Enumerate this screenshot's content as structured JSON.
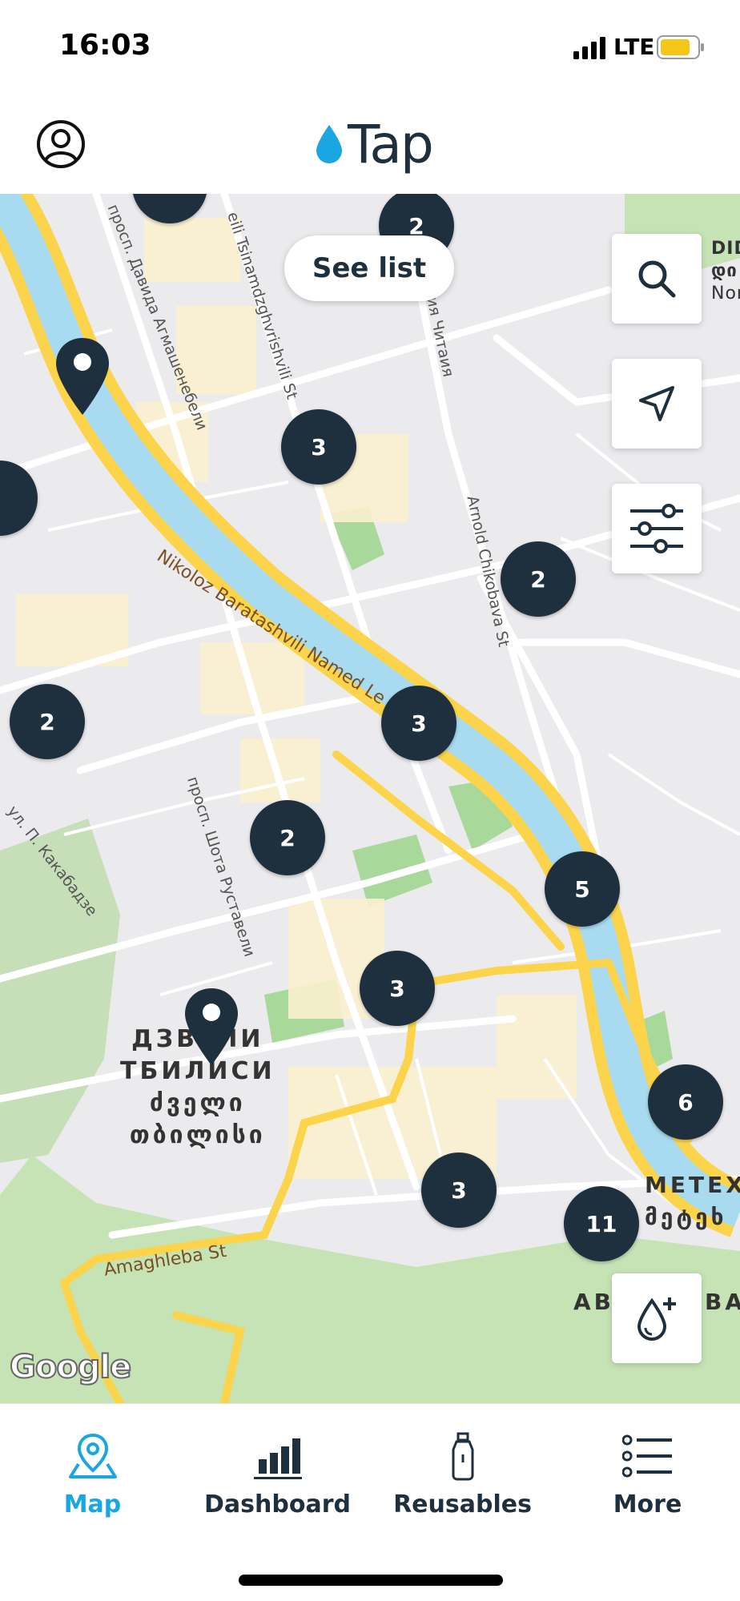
{
  "status_bar": {
    "time": "16:03",
    "network": "LTE",
    "battery_color": "#f5c518"
  },
  "header": {
    "logo_text": "Tap",
    "brand_color": "#1aa6e0",
    "profile_icon": "user-circle-icon"
  },
  "map": {
    "see_list_label": "See list",
    "controls": [
      "search-icon",
      "navigation-arrow-icon",
      "filter-sliders-icon",
      "add-refill-icon"
    ],
    "clusters": [
      "2",
      "3",
      "2",
      "2",
      "3",
      "2",
      "5",
      "3",
      "6",
      "3",
      "11"
    ],
    "labels": {
      "river_street": "Nikoloz Baratashvili Named Le",
      "arnold": "Arnold Chikobava St",
      "tsinamdzghvrishvili": "eili Tsinamdzghvrishvili St",
      "davida": "просп. Давида Агмашенебели",
      "chitaia": "ргия Читаия",
      "kakabadze": "ул. П. Какабадзе",
      "shota": "просп. Шота Руставели",
      "amaghleba": "Amaghleba St",
      "district_line1": "ДЗВЕЛИ",
      "district_line2": "ТБИЛИСИ",
      "district_line3": "ძველი",
      "district_line4": "თბილისი",
      "metekhi_ru": "МЕТЕХ",
      "metekhi_ka": "მეტეხ",
      "ab": "AB",
      "ba": "BA",
      "did": "DID",
      "did_ka": "დი",
      "nor": "Nor"
    },
    "attribution": "Google",
    "colors": {
      "road_major": "#fbd44b",
      "river": "#a8dbf0",
      "park": "#bfe0b0",
      "marker": "#1e2f3d"
    }
  },
  "nav": {
    "items": [
      {
        "label": "Map",
        "icon": "map-pin-icon",
        "active": true
      },
      {
        "label": "Dashboard",
        "icon": "bar-chart-icon",
        "active": false
      },
      {
        "label": "Reusables",
        "icon": "bottle-icon",
        "active": false
      },
      {
        "label": "More",
        "icon": "list-icon",
        "active": false
      }
    ]
  }
}
